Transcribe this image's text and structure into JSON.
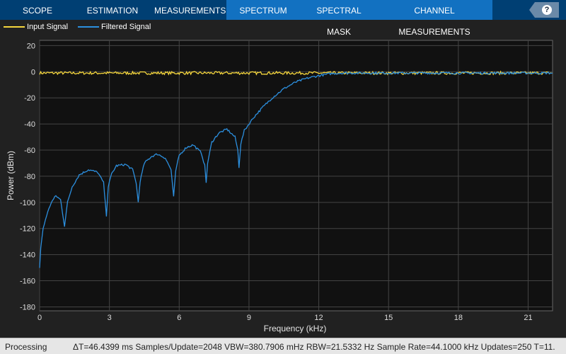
{
  "tabs": [
    {
      "label": "SCOPE"
    },
    {
      "label": "ESTIMATION"
    },
    {
      "label": "MEASUREMENTS"
    },
    {
      "label": "SPECTRUM",
      "selected": true
    },
    {
      "label": "SPECTRAL MASK",
      "selected": true
    },
    {
      "label": "CHANNEL MEASUREMENTS",
      "selected": true
    }
  ],
  "help": {
    "label": "?",
    "icon": "help-icon"
  },
  "legend": [
    {
      "label": "Input Signal",
      "color": "#f5d63d"
    },
    {
      "label": "Filtered Signal",
      "color": "#2c8fde"
    }
  ],
  "status": {
    "state": "Processing",
    "info": "ΔT=46.4399 ms  Samples/Update=2048  VBW=380.7906 mHz  RBW=21.5332 Hz  Sample Rate=44.1000 kHz  Updates=250  T=11."
  },
  "chart_data": {
    "type": "line",
    "xlabel": "Frequency (kHz)",
    "ylabel": "Power (dBm)",
    "xlim": [
      0,
      22.05
    ],
    "ylim": [
      -183,
      24
    ],
    "xticks": [
      0,
      3,
      6,
      9,
      12,
      15,
      18,
      21
    ],
    "yticks": [
      20,
      0,
      -20,
      -40,
      -60,
      -80,
      -100,
      -120,
      -140,
      -160,
      -180
    ],
    "grid": true,
    "legend_position": "top-left",
    "series": [
      {
        "name": "Input Signal",
        "color": "#f5d63d",
        "x": [
          0,
          2,
          4,
          6,
          8,
          10,
          12,
          14,
          16,
          18,
          20,
          22.05
        ],
        "y": [
          -1,
          -1,
          -1,
          -1,
          -1,
          -1,
          -1,
          -1,
          -1,
          -1,
          -1,
          -1
        ]
      },
      {
        "name": "Filtered Signal",
        "color": "#2c8fde",
        "x": [
          0,
          0.05,
          0.15,
          0.3,
          0.5,
          0.7,
          0.9,
          1.07,
          1.2,
          1.4,
          1.7,
          2.1,
          2.5,
          2.75,
          2.87,
          2.95,
          3.1,
          3.3,
          3.7,
          4.0,
          4.15,
          4.24,
          4.32,
          4.5,
          4.8,
          5.06,
          5.4,
          5.65,
          5.76,
          5.85,
          6.0,
          6.3,
          6.6,
          6.95,
          7.1,
          7.16,
          7.22,
          7.4,
          7.7,
          8.05,
          8.4,
          8.52,
          8.57,
          8.65,
          8.8,
          9.2,
          9.6,
          10.0,
          10.5,
          11.0,
          11.5,
          12.0,
          12.5,
          13.0,
          14,
          16,
          18,
          20,
          22.05
        ],
        "y": [
          -150,
          -135,
          -120,
          -110,
          -100,
          -95,
          -98,
          -118,
          -100,
          -88,
          -79,
          -75,
          -77,
          -85,
          -110,
          -88,
          -78,
          -72,
          -71,
          -75,
          -85,
          -100,
          -84,
          -70,
          -65,
          -63,
          -66,
          -75,
          -96,
          -76,
          -64,
          -58,
          -56,
          -62,
          -72,
          -85,
          -70,
          -54,
          -47,
          -44,
          -50,
          -60,
          -73,
          -55,
          -45,
          -35,
          -27,
          -20,
          -13,
          -8,
          -5,
          -3,
          -1.5,
          -1,
          -1,
          -1,
          -1,
          -1,
          -1
        ]
      }
    ]
  }
}
